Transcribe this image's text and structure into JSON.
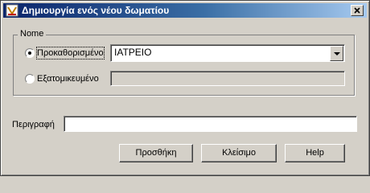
{
  "window": {
    "title": "Δημιουργία ενός νέου δωματίου"
  },
  "name_group": {
    "legend": "Nome",
    "predefined": {
      "label": "Προκαθορισμένο",
      "selected": true,
      "value": "ΙΑΤΡΕΙΟ"
    },
    "custom": {
      "label": "Εξατομικευμένο",
      "selected": false,
      "value": ""
    }
  },
  "description": {
    "label": "Περιγραφή",
    "value": ""
  },
  "buttons": {
    "add": "Προσθήκη",
    "close": "Κλείσιμο",
    "help": "Help"
  },
  "icons": {
    "app": "app-icon",
    "close": "close-icon",
    "dropdown": "chevron-down-icon"
  },
  "colors": {
    "titlebar_start": "#0a246a",
    "titlebar_end": "#a6caf0",
    "face": "#d4d0c8"
  }
}
